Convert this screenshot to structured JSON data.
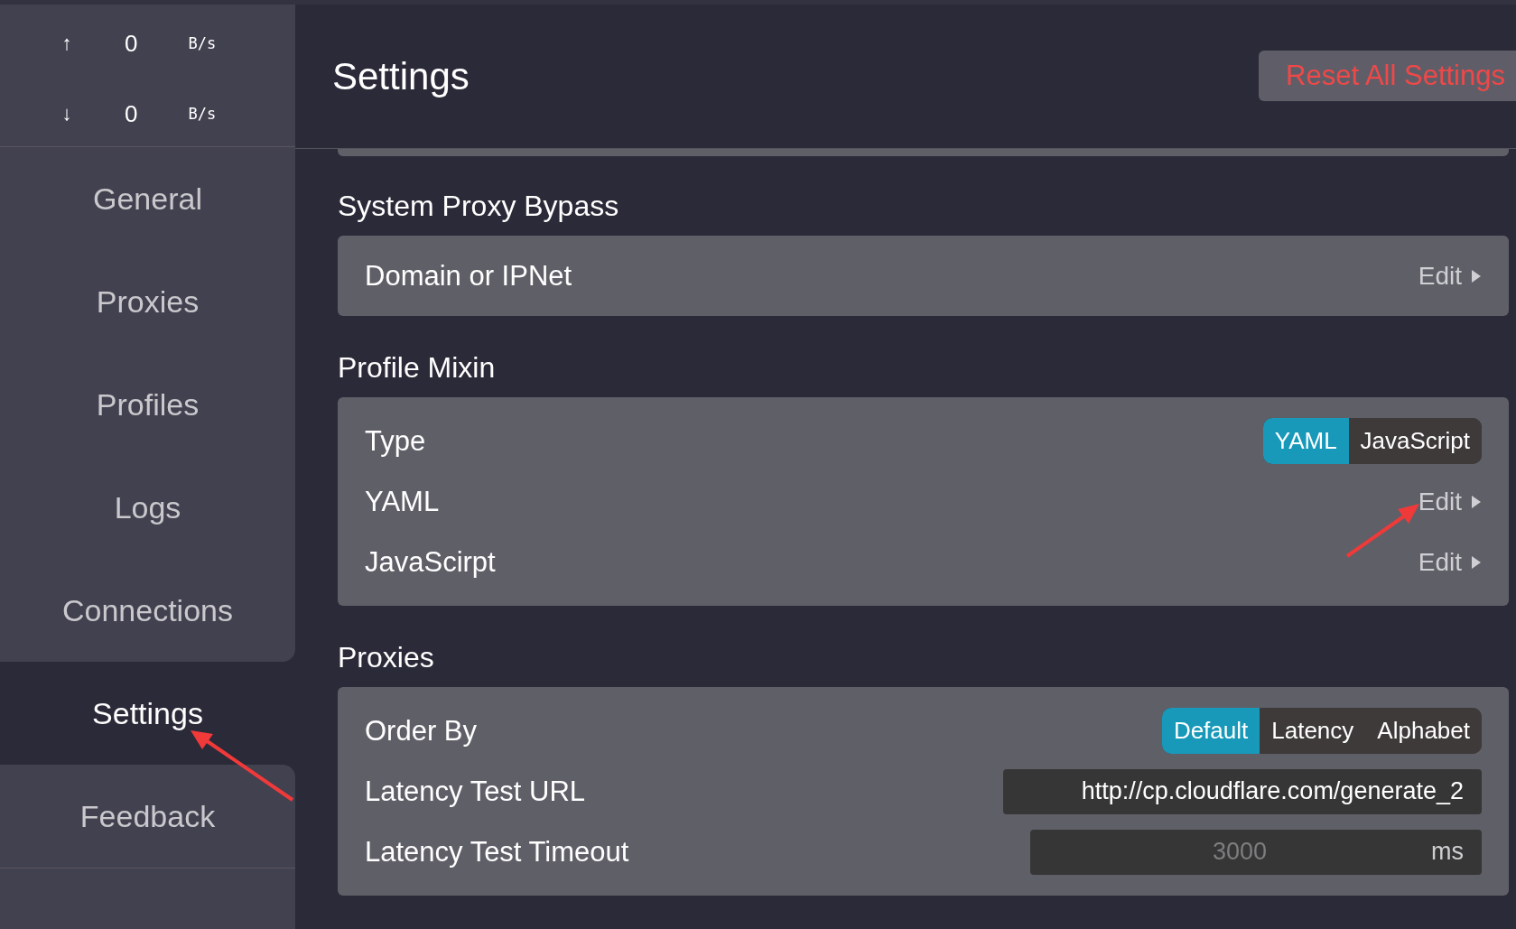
{
  "traffic": [
    {
      "arrow": "↑",
      "value": "0",
      "unit": "B/s"
    },
    {
      "arrow": "↓",
      "value": "0",
      "unit": "B/s"
    }
  ],
  "sidebar": {
    "items": [
      {
        "label": "General",
        "selected": false
      },
      {
        "label": "Proxies",
        "selected": false
      },
      {
        "label": "Profiles",
        "selected": false
      },
      {
        "label": "Logs",
        "selected": false
      },
      {
        "label": "Connections",
        "selected": false
      },
      {
        "label": "Settings",
        "selected": true
      },
      {
        "label": "Feedback",
        "selected": false
      }
    ]
  },
  "header": {
    "title": "Settings",
    "reset_button": "Reset All Settings"
  },
  "sections": [
    {
      "title": "System Proxy Bypass",
      "rows": [
        {
          "kind": "link",
          "label": "Domain or IPNet",
          "action": "Edit"
        }
      ]
    },
    {
      "title": "Profile Mixin",
      "rows": [
        {
          "kind": "segmented",
          "label": "Type",
          "options": [
            {
              "label": "YAML",
              "selected": true
            },
            {
              "label": "JavaScript",
              "selected": false
            }
          ]
        },
        {
          "kind": "link",
          "label": "YAML",
          "action": "Edit"
        },
        {
          "kind": "link",
          "label": "JavaScirpt",
          "action": "Edit"
        }
      ]
    },
    {
      "title": "Proxies",
      "rows": [
        {
          "kind": "segmented",
          "label": "Order By",
          "options": [
            {
              "label": "Default",
              "selected": true
            },
            {
              "label": "Latency",
              "selected": false
            },
            {
              "label": "Alphabet",
              "selected": false
            }
          ]
        },
        {
          "kind": "input",
          "label": "Latency Test URL",
          "value": "http://cp.cloudflare.com/generate_2"
        },
        {
          "kind": "number",
          "label": "Latency Test Timeout",
          "placeholder": "3000",
          "unit": "ms"
        }
      ]
    }
  ]
}
